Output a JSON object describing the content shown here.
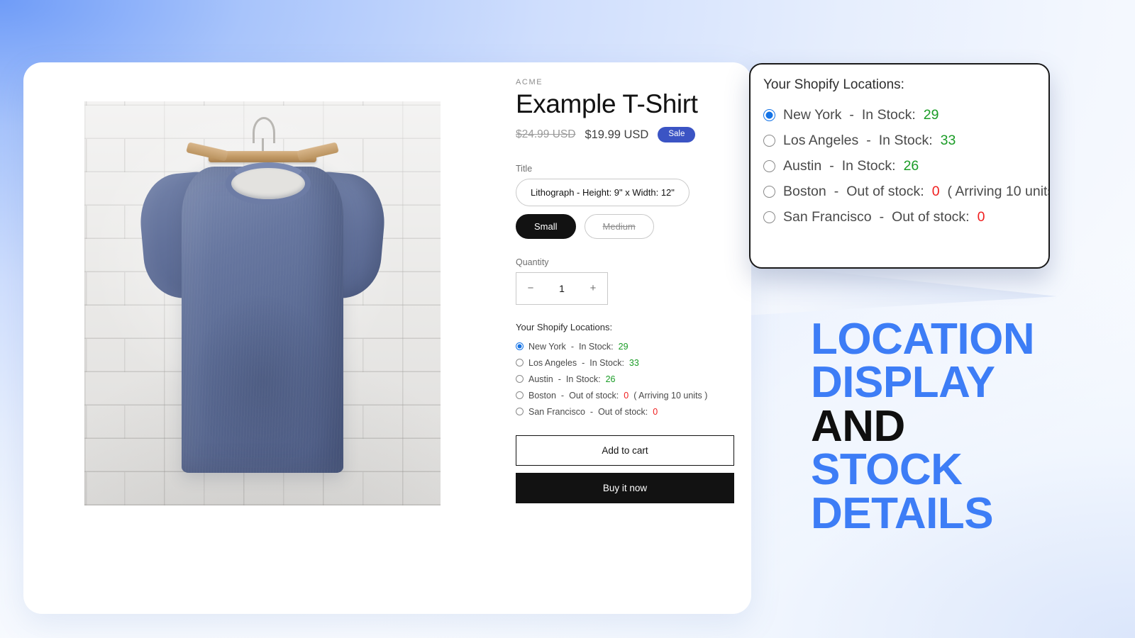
{
  "theme": {
    "accent_blue": "#3d7df6",
    "sale_badge_blue": "#3b54c4",
    "radio_blue": "#1473e6",
    "in_stock_green": "#1a9c26",
    "out_of_stock_red": "#f01e1e",
    "card_white": "#ffffff",
    "text_dark": "#121212"
  },
  "product": {
    "vendor": "ACME",
    "title": "Example T-Shirt",
    "price_compare_at": "$24.99 USD",
    "price_current": "$19.99 USD",
    "sale_badge": "Sale",
    "image_alt": "Blue t-shirt on a wooden hanger against a white brick wall",
    "option_title_label": "Title",
    "option_title_value": "Lithograph - Height: 9\" x Width: 12\"",
    "sizes": [
      {
        "label": "Small",
        "state": "selected"
      },
      {
        "label": "Medium",
        "state": "unavailable"
      }
    ],
    "quantity_label": "Quantity",
    "quantity_value": "1",
    "quantity_decrement": "−",
    "quantity_increment": "+",
    "add_to_cart_label": "Add to cart",
    "buy_it_now_label": "Buy it now"
  },
  "locations": {
    "heading": "Your Shopify Locations:",
    "items": [
      {
        "name": "New York",
        "status_label": "In Stock:",
        "count": "29",
        "in_stock": true,
        "selected": true,
        "note": ""
      },
      {
        "name": "Los Angeles",
        "status_label": "In Stock:",
        "count": "33",
        "in_stock": true,
        "selected": false,
        "note": ""
      },
      {
        "name": "Austin",
        "status_label": "In Stock:",
        "count": "26",
        "in_stock": true,
        "selected": false,
        "note": ""
      },
      {
        "name": "Boston",
        "status_label": "Out of stock:",
        "count": "0",
        "in_stock": false,
        "selected": false,
        "note": "( Arriving 10 units )"
      },
      {
        "name": "San Francisco",
        "status_label": "Out of stock:",
        "count": "0",
        "in_stock": false,
        "selected": false,
        "note": ""
      }
    ]
  },
  "headline": {
    "line1": "LOCATION",
    "line2": "DISPLAY",
    "line3": "AND",
    "line4": "STOCK",
    "line5": "DETAILS"
  }
}
